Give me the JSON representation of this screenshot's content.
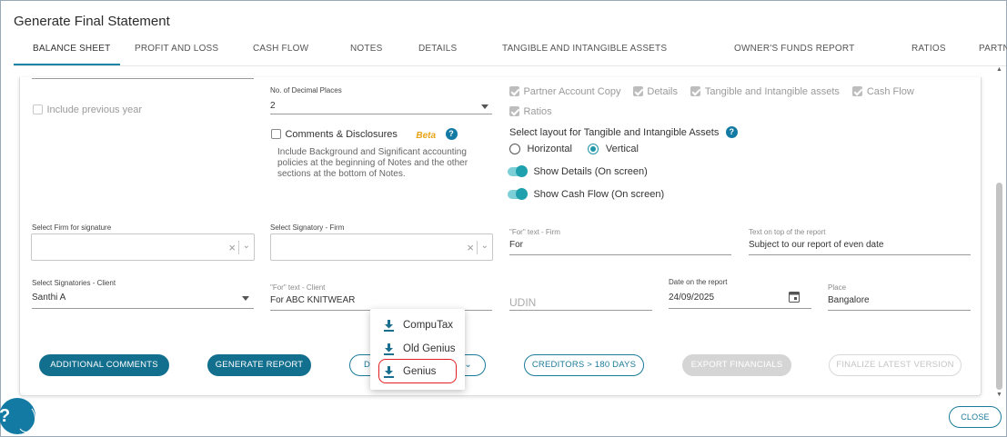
{
  "window": {
    "title": "Generate Final Statement"
  },
  "tabs": [
    {
      "label": "BALANCE SHEET",
      "active": true
    },
    {
      "label": "PROFIT AND LOSS"
    },
    {
      "label": "CASH FLOW"
    },
    {
      "label": "NOTES"
    },
    {
      "label": "DETAILS"
    },
    {
      "label": "TANGIBLE AND INTANGIBLE ASSETS"
    },
    {
      "label": "OWNER'S FUNDS REPORT"
    },
    {
      "label": "RATIOS"
    },
    {
      "label": "PARTNE"
    }
  ],
  "options": {
    "include_previous_year": {
      "label": "Include previous year",
      "checked": false
    },
    "decimal_places": {
      "label": "No. of Decimal Places",
      "value": "2"
    },
    "comments_disclosures": {
      "label": "Comments & Disclosures",
      "checked": false,
      "beta": "Beta",
      "help": "?",
      "description": "Include Background and Significant accounting policies at the beginning of Notes and the other sections at the bottom of Notes."
    },
    "reports": [
      {
        "label": "Partner Account Copy",
        "checked": true
      },
      {
        "label": "Details",
        "checked": true
      },
      {
        "label": "Tangible and Intangible assets",
        "checked": true
      },
      {
        "label": "Cash Flow",
        "checked": true
      },
      {
        "label": "Ratios",
        "checked": true
      }
    ],
    "layout": {
      "label": "Select layout for Tangible and Intangible Assets",
      "help": "?",
      "choices": [
        "Horizontal",
        "Vertical"
      ],
      "selected": "Vertical"
    },
    "show_details": {
      "label": "Show Details (On screen)",
      "on": true
    },
    "show_cash_flow": {
      "label": "Show Cash Flow (On screen)",
      "on": true
    }
  },
  "fields": {
    "firm_signature": {
      "label": "Select Firm for signature",
      "value": ""
    },
    "signatory_firm": {
      "label": "Select Signatory - Firm",
      "value": ""
    },
    "for_text_firm": {
      "label": "\"For\" text - Firm",
      "value": "For"
    },
    "text_on_top": {
      "label": "Text on top of the report",
      "value": "Subject to our report of even date"
    },
    "signatories_client": {
      "label": "Select Signatories - Client",
      "value": "Santhi A"
    },
    "for_text_client": {
      "label": "\"For\" text - Client",
      "value": "For ABC KNITWEAR"
    },
    "udin": {
      "placeholder": "UDIN",
      "value": ""
    },
    "date_on_report": {
      "label": "Date on the report",
      "value": "24/09/2025"
    },
    "place": {
      "label": "Place",
      "value": "Bangalore"
    }
  },
  "icons": {
    "clear": "×",
    "chevron": "⌄",
    "calendar": "calendar-icon",
    "download": "download-icon"
  },
  "buttons": {
    "additional_comments": "ADDITIONAL COMMENTS",
    "generate_report": "GENERATE REPORT",
    "download_partial": "D",
    "creditors": "CREDITORS > 180 DAYS",
    "export_financials": "EXPORT FINANCIALS",
    "finalize": "FINALIZE LATEST VERSION",
    "close": "CLOSE"
  },
  "download_menu": {
    "items": [
      {
        "label": "CompuTax"
      },
      {
        "label": "Old Genius"
      },
      {
        "label": "Genius",
        "highlighted": true
      }
    ]
  },
  "help_fab": {
    "label": "?"
  },
  "colors": {
    "accent": "#137aa4",
    "toggle": "#1fa0ad",
    "beta": "#e8a317",
    "highlight": "#e02020"
  }
}
